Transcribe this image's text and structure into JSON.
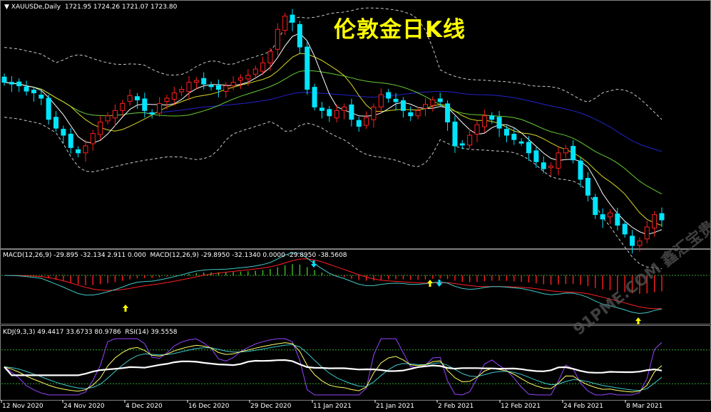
{
  "chart_data": [
    {
      "type": "candlestick",
      "title": "伦敦金日K线",
      "symbol": "XAUUSDe,Daily",
      "ohlc_label": "1721.95 1724.26 1721.07 1723.80",
      "x_labels": [
        "12 Nov 2020",
        "24 Nov 2020",
        "4 Dec 2020",
        "16 Dec 2020",
        "29 Dec 2020",
        "11 Jan 2021",
        "21 Jan 2021",
        "2 Feb 2021",
        "12 Feb 2021",
        "24 Feb 2021",
        "8 Mar 2021"
      ],
      "close_path": [
        1880,
        1878,
        1876,
        1870,
        1868,
        1862,
        1838,
        1828,
        1820,
        1806,
        1800,
        1808,
        1822,
        1835,
        1842,
        1848,
        1856,
        1865,
        1860,
        1848,
        1845,
        1856,
        1862,
        1868,
        1872,
        1880,
        1882,
        1878,
        1875,
        1872,
        1876,
        1880,
        1885,
        1888,
        1895,
        1902,
        1915,
        1940,
        1955,
        1948,
        1920,
        1872,
        1852,
        1848,
        1842,
        1848,
        1852,
        1838,
        1830,
        1840,
        1852,
        1866,
        1862,
        1858,
        1848,
        1842,
        1848,
        1855,
        1860,
        1858,
        1835,
        1808,
        1810,
        1820,
        1832,
        1842,
        1838,
        1828,
        1820,
        1815,
        1812,
        1800,
        1790,
        1782,
        1785,
        1800,
        1805,
        1792,
        1770,
        1752,
        1730,
        1725,
        1732,
        1718,
        1708,
        1695,
        1700,
        1716,
        1730,
        1724
      ],
      "moving_averages": [
        "short",
        "medium",
        "long"
      ],
      "bands": "bollinger"
    },
    {
      "type": "macd",
      "label": "MACD(12,26,9) -29.895 -32.134 2.911 0.000  MACD(12,26,9) -29.8950 -32.1340 0.0000 -29.8950 -38.5608"
    },
    {
      "type": "kdj_rsi",
      "label": "KDJ(9,3,3) 49.4417 33.6733 80.9786  RSI(14) 39.5558"
    }
  ],
  "watermark": "91PME.COM",
  "watermark_sub": "鑫汇宝贵金属",
  "colors": {
    "bull": "#ff2020",
    "bear": "#00e5ff",
    "band": "#c8c8c8",
    "ma_short": "#ffffff",
    "ma_mid": "#d8d820",
    "ma_long": "#66cc33",
    "ma_trend": "#2222cc",
    "hist_pos": "#44bb22",
    "hist_neg": "#ff2020",
    "signal": "#ff2020",
    "macd_line": "#40c8c8",
    "arrow_up": "#ffff00",
    "arrow_down": "#00e5ff",
    "k": "#ffff66",
    "d": "#40c8c8",
    "j": "#9944ff",
    "rsi": "#ffffff",
    "level": "#33aa33"
  }
}
